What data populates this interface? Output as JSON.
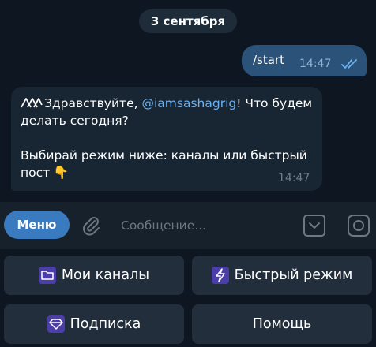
{
  "date_separator": "3 сентября",
  "outgoing": {
    "text": "/start",
    "time": "14:47"
  },
  "incoming": {
    "greeting_prefix": "Здравствуйте, ",
    "mention": "@iamsashagrig",
    "greeting_suffix": "! Что будем",
    "line2": "делать сегодня?",
    "line3": "Выбирай режим ниже: каналы или быстрый",
    "line4": "пост",
    "emoji": "👇",
    "time": "14:47"
  },
  "composer": {
    "menu_label": "Меню",
    "placeholder": "Сообщение..."
  },
  "keyboard": {
    "channels": {
      "icon": "folder-icon",
      "label": "Мои каналы"
    },
    "fast": {
      "icon": "lightning-icon",
      "label": "Быстрый режим"
    },
    "subscription": {
      "icon": "gem-icon",
      "label": "Подписка"
    },
    "help": {
      "label": "Помощь"
    }
  },
  "colors": {
    "background": "#0e1621",
    "outgoing_bubble": "#2b5278",
    "incoming_bubble": "#182533",
    "accent": "#3a7bbf",
    "mention": "#6ab3f3",
    "button": "#232e3c"
  }
}
